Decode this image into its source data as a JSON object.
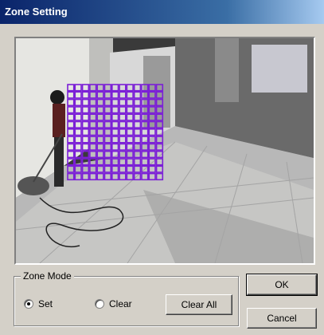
{
  "window": {
    "title": "Zone Setting"
  },
  "zone_mode": {
    "label": "Zone Mode",
    "options": [
      {
        "label": "Set",
        "selected": true
      },
      {
        "label": "Clear",
        "selected": false
      }
    ],
    "clear_all_label": "Clear All"
  },
  "buttons": {
    "ok_label": "OK",
    "cancel_label": "Cancel"
  },
  "zone_grid": {
    "color": "#7b1fd6",
    "rows": 13,
    "cols": 13,
    "marked": "all"
  },
  "colors": {
    "title_bar": "#0a246a",
    "dialog_bg": "#d4d0c8"
  }
}
